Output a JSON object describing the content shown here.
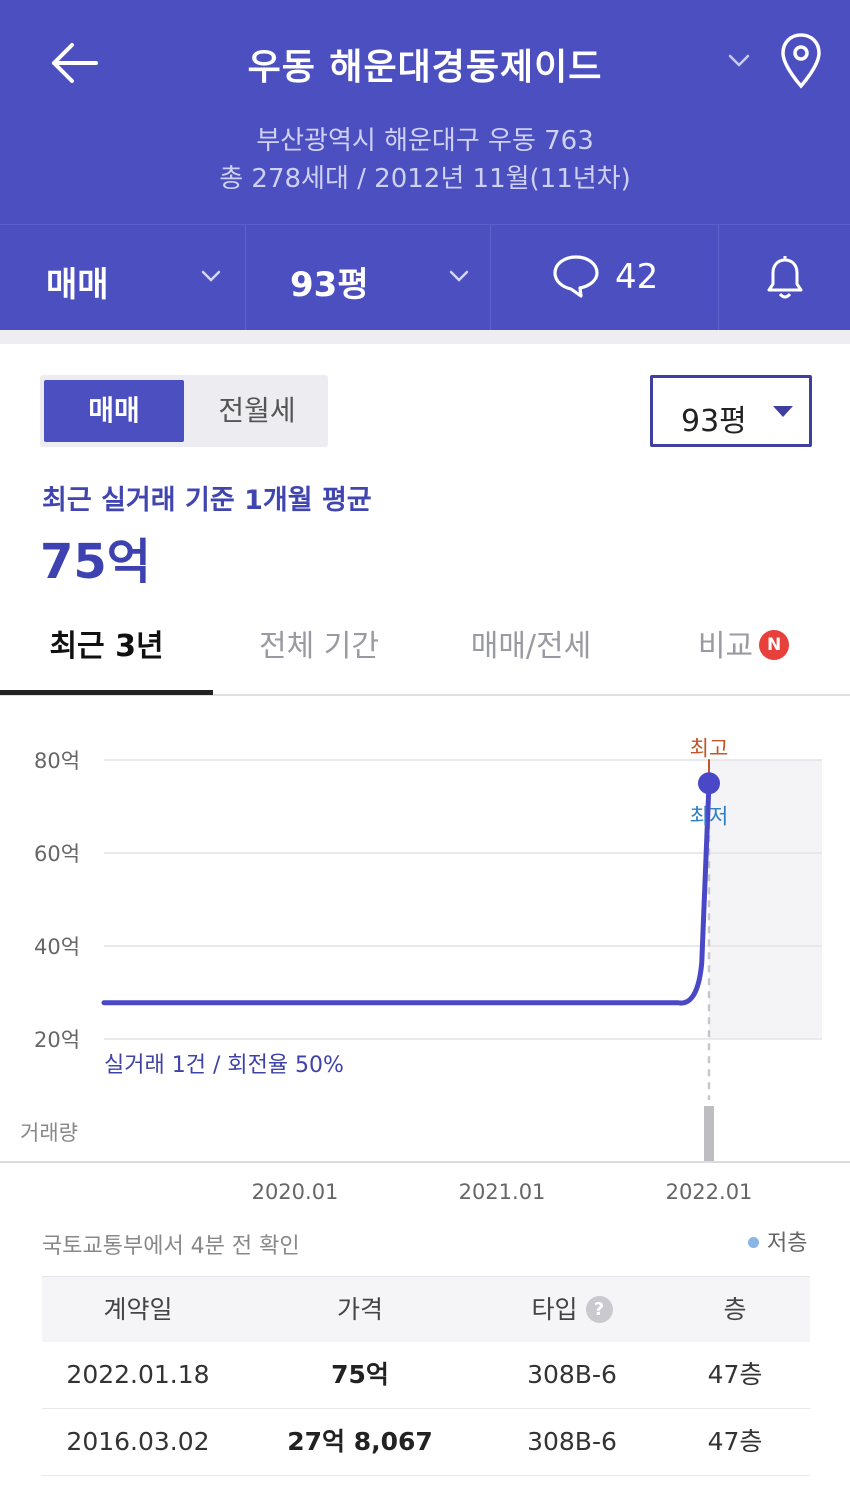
{
  "header": {
    "title": "우동 해운대경동제이드",
    "address": "부산광역시 해운대구 우동 763",
    "summary": "총 278세대 / 2012년 11월(11년차)"
  },
  "subbar": {
    "trade_type": "매매",
    "size": "93평",
    "comment_count": "42"
  },
  "toggle": {
    "option_sale": "매매",
    "option_rent": "전월세",
    "selected": "매매"
  },
  "size_select": {
    "value": "93평"
  },
  "average": {
    "label": "최근 실거래 기준 1개월 평균",
    "value": "75억"
  },
  "tabs": [
    {
      "label": "최근 3년"
    },
    {
      "label": "전체 기간"
    },
    {
      "label": "매매/전세"
    },
    {
      "label": "비교"
    }
  ],
  "tab_badge": "N",
  "chart_data": {
    "type": "line",
    "y_tick_labels": [
      "80억",
      "60억",
      "40억",
      "20억"
    ],
    "y_ticks": [
      80,
      60,
      40,
      20
    ],
    "ylim": [
      20,
      80
    ],
    "x_tick_labels": [
      "2020.01",
      "2021.01",
      "2022.01"
    ],
    "series": [
      {
        "values": [
          {
            "date": "2019.01",
            "price": 27.8
          },
          {
            "date": "2021.12",
            "price": 27.8
          },
          {
            "date": "2022.01",
            "price": 75
          }
        ]
      }
    ],
    "marker_high_label": "최고",
    "marker_low_label": "최저",
    "info_text": "실거래 1건 / 회전율 50%",
    "volume_label": "거래량",
    "volume": [
      {
        "date": "2022.01",
        "count": 1
      }
    ],
    "colors": {
      "line": "#4a48c6",
      "high": "#c0562b",
      "low": "#2d7fc4"
    }
  },
  "source_text": "국토교통부에서 4분 전 확인",
  "legend": {
    "low_floor": "저층",
    "low_floor_color": "#8ab6e6"
  },
  "table": {
    "headers": [
      "계약일",
      "가격",
      "타입",
      "층"
    ],
    "rows": [
      [
        "2022.01.18",
        "75억",
        "308B-6",
        "47층"
      ],
      [
        "2016.03.02",
        "27억 8,067",
        "308B-6",
        "47층"
      ]
    ]
  },
  "colors": {
    "brand": "#4b4fbf",
    "badge": "#e8403a"
  }
}
